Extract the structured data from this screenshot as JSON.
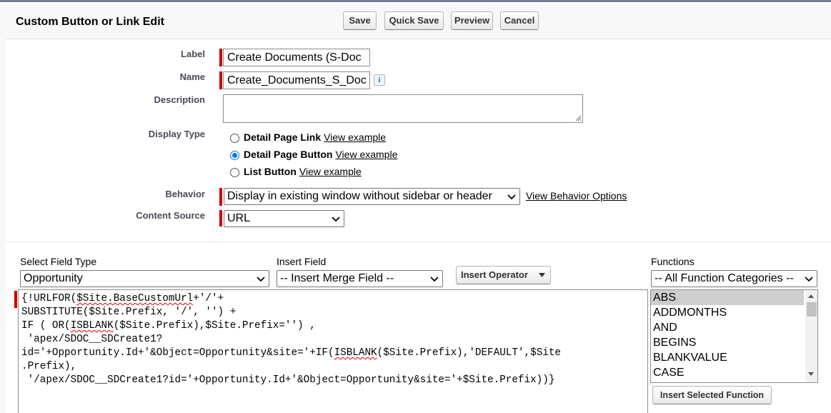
{
  "header": {
    "title": "Custom Button or Link Edit",
    "buttons": {
      "save": "Save",
      "quick_save": "Quick Save",
      "preview": "Preview",
      "cancel": "Cancel"
    }
  },
  "form": {
    "label": {
      "label": "Label",
      "value": "Create Documents (S-Doc"
    },
    "name": {
      "label": "Name",
      "value": "Create_Documents_S_Doc",
      "info_icon": "info-icon"
    },
    "description": {
      "label": "Description",
      "value": ""
    },
    "display_type": {
      "label": "Display Type",
      "options": [
        {
          "label": "Detail Page Link",
          "link": "View example",
          "checked": false
        },
        {
          "label": "Detail Page Button",
          "link": "View example",
          "checked": true
        },
        {
          "label": "List Button",
          "link": "View example",
          "checked": false
        }
      ]
    },
    "behavior": {
      "label": "Behavior",
      "value": "Display in existing window without sidebar or header",
      "link": "View Behavior Options"
    },
    "content_source": {
      "label": "Content Source",
      "value": "URL"
    }
  },
  "formula": {
    "field_type": {
      "label": "Select Field Type",
      "value": "Opportunity"
    },
    "insert_field": {
      "label": "Insert Field",
      "value": "-- Insert Merge Field --"
    },
    "insert_operator": "Insert Operator",
    "code_lines": [
      "{!URLFOR($Site.BaseCustomUrl+'/'+",
      "SUBSTITUTE($Site.Prefix, '/', '') +",
      "IF ( OR(ISBLANK($Site.Prefix),$Site.Prefix='') ,",
      " 'apex/SDOC__SDCreate1?",
      "id='+Opportunity.Id+'&Object=Opportunity&site='+IF(ISBLANK($Site.Prefix),'DEFAULT',$Site",
      ".Prefix),",
      " '/apex/SDOC__SDCreate1?id='+Opportunity.Id+'&Object=Opportunity&site='+$Site.Prefix))}"
    ],
    "functions": {
      "label": "Functions",
      "category": "-- All Function Categories --",
      "items": [
        "ABS",
        "ADDMONTHS",
        "AND",
        "BEGINS",
        "BLANKVALUE",
        "CASE"
      ],
      "selected": "ABS",
      "insert_button": "Insert Selected Function"
    }
  },
  "colors": {
    "required_bar": "#cc0000",
    "header_border": "#747e96",
    "radio_checked": "#0075ff"
  }
}
